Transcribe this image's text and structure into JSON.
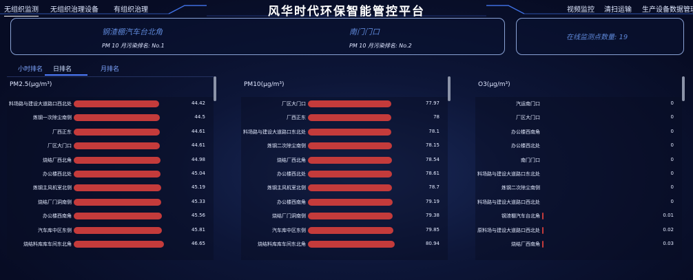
{
  "header": {
    "title": "风华时代环保智能管控平台",
    "left_nav": [
      "无组织监测",
      "无组织治理设备",
      "有组织治理"
    ],
    "right_nav": [
      "视频监控",
      "清扫运输",
      "生产设备数据管理"
    ]
  },
  "locations": [
    {
      "name": "钢渣棚汽车台北角",
      "standard": "PM 10 月污染排名: No.1"
    },
    {
      "name": "南门门口",
      "standard": "PM 10 月污染排名: No.2"
    }
  ],
  "monitor_count_label": "在线监测点数量: 19",
  "tabs": [
    "小时排名",
    "日排名",
    "月排名"
  ],
  "active_tab": 1,
  "bar_color": "#c43b3b",
  "rankings": [
    {
      "title": "PM2.5(μg/m³)",
      "max": 50,
      "rows": [
        {
          "label": "料场路与建设大道路口西北处",
          "value": "44.42"
        },
        {
          "label": "炼钢一次除尘南侧",
          "value": "44.5"
        },
        {
          "label": "厂西正东",
          "value": "44.61"
        },
        {
          "label": "厂区大门口",
          "value": "44.61"
        },
        {
          "label": "烧结厂西北角",
          "value": "44.98"
        },
        {
          "label": "办公楼西北处",
          "value": "45.04"
        },
        {
          "label": "炼钢主风机室北侧",
          "value": "45.19"
        },
        {
          "label": "烧结厂门洞南侧",
          "value": "45.33"
        },
        {
          "label": "办公楼西南角",
          "value": "45.56"
        },
        {
          "label": "汽车库中区东侧",
          "value": "45.81"
        },
        {
          "label": "烧结料库库车间东北角",
          "value": "46.65"
        }
      ]
    },
    {
      "title": "PM10(μg/m³)",
      "max": 90,
      "rows": [
        {
          "label": "厂区大门口",
          "value": "77.97"
        },
        {
          "label": "厂西正东",
          "value": "78"
        },
        {
          "label": "料场路与建设大道路口东北处",
          "value": "78.1"
        },
        {
          "label": "炼钢二次除尘南侧",
          "value": "78.15"
        },
        {
          "label": "烧结厂西北角",
          "value": "78.54"
        },
        {
          "label": "办公楼西北处",
          "value": "78.61"
        },
        {
          "label": "炼钢主风机室北侧",
          "value": "78.7"
        },
        {
          "label": "办公楼西南角",
          "value": "79.19"
        },
        {
          "label": "烧结厂门洞南侧",
          "value": "79.38"
        },
        {
          "label": "汽车库中区东侧",
          "value": "79.85"
        },
        {
          "label": "烧结料库库车间东北角",
          "value": "80.94"
        }
      ]
    },
    {
      "title": "O3(μg/m³)",
      "max": 2,
      "rows": [
        {
          "label": "汽运南门口",
          "value": "0"
        },
        {
          "label": "厂区大门口",
          "value": "0"
        },
        {
          "label": "办公楼西南角",
          "value": "0"
        },
        {
          "label": "办公楼西北处",
          "value": "0"
        },
        {
          "label": "南门门口",
          "value": "0"
        },
        {
          "label": "料场路与建设大道路口东北处",
          "value": "0"
        },
        {
          "label": "炼钢二次除尘南侧",
          "value": "0"
        },
        {
          "label": "料场路与建设大道路口西北处",
          "value": "0"
        },
        {
          "label": "钢渣棚汽车台北角",
          "value": "0.01"
        },
        {
          "label": "原料场与建设大道路口西北处",
          "value": "0.02"
        },
        {
          "label": "烧结厂西南角",
          "value": "0.03"
        }
      ]
    }
  ]
}
